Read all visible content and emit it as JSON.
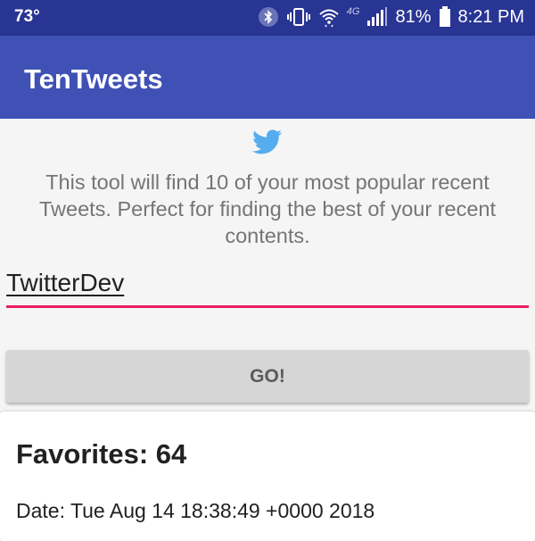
{
  "status_bar": {
    "temperature": "73°",
    "network": "4G",
    "battery": "81%",
    "time": "8:21 PM",
    "icons": [
      "bluetooth-icon",
      "vibrate-icon",
      "wifi-icon",
      "signal-icon",
      "battery-icon"
    ]
  },
  "app_bar": {
    "title": "TenTweets"
  },
  "main": {
    "logo_icon": "twitter-bird-icon",
    "description": "This tool will find 10 of your most popular recent Tweets. Perfect for finding the best of your recent contents.",
    "username_value": "TwitterDev",
    "go_label": "GO!"
  },
  "result": {
    "favorites": "Favorites: 64",
    "date": "Date: Tue Aug 14 18:38:49 +0000 2018"
  },
  "colors": {
    "status_bar": "#283593",
    "app_bar": "#3f51b5",
    "accent": "#e91e63",
    "twitter_blue": "#55acee"
  }
}
